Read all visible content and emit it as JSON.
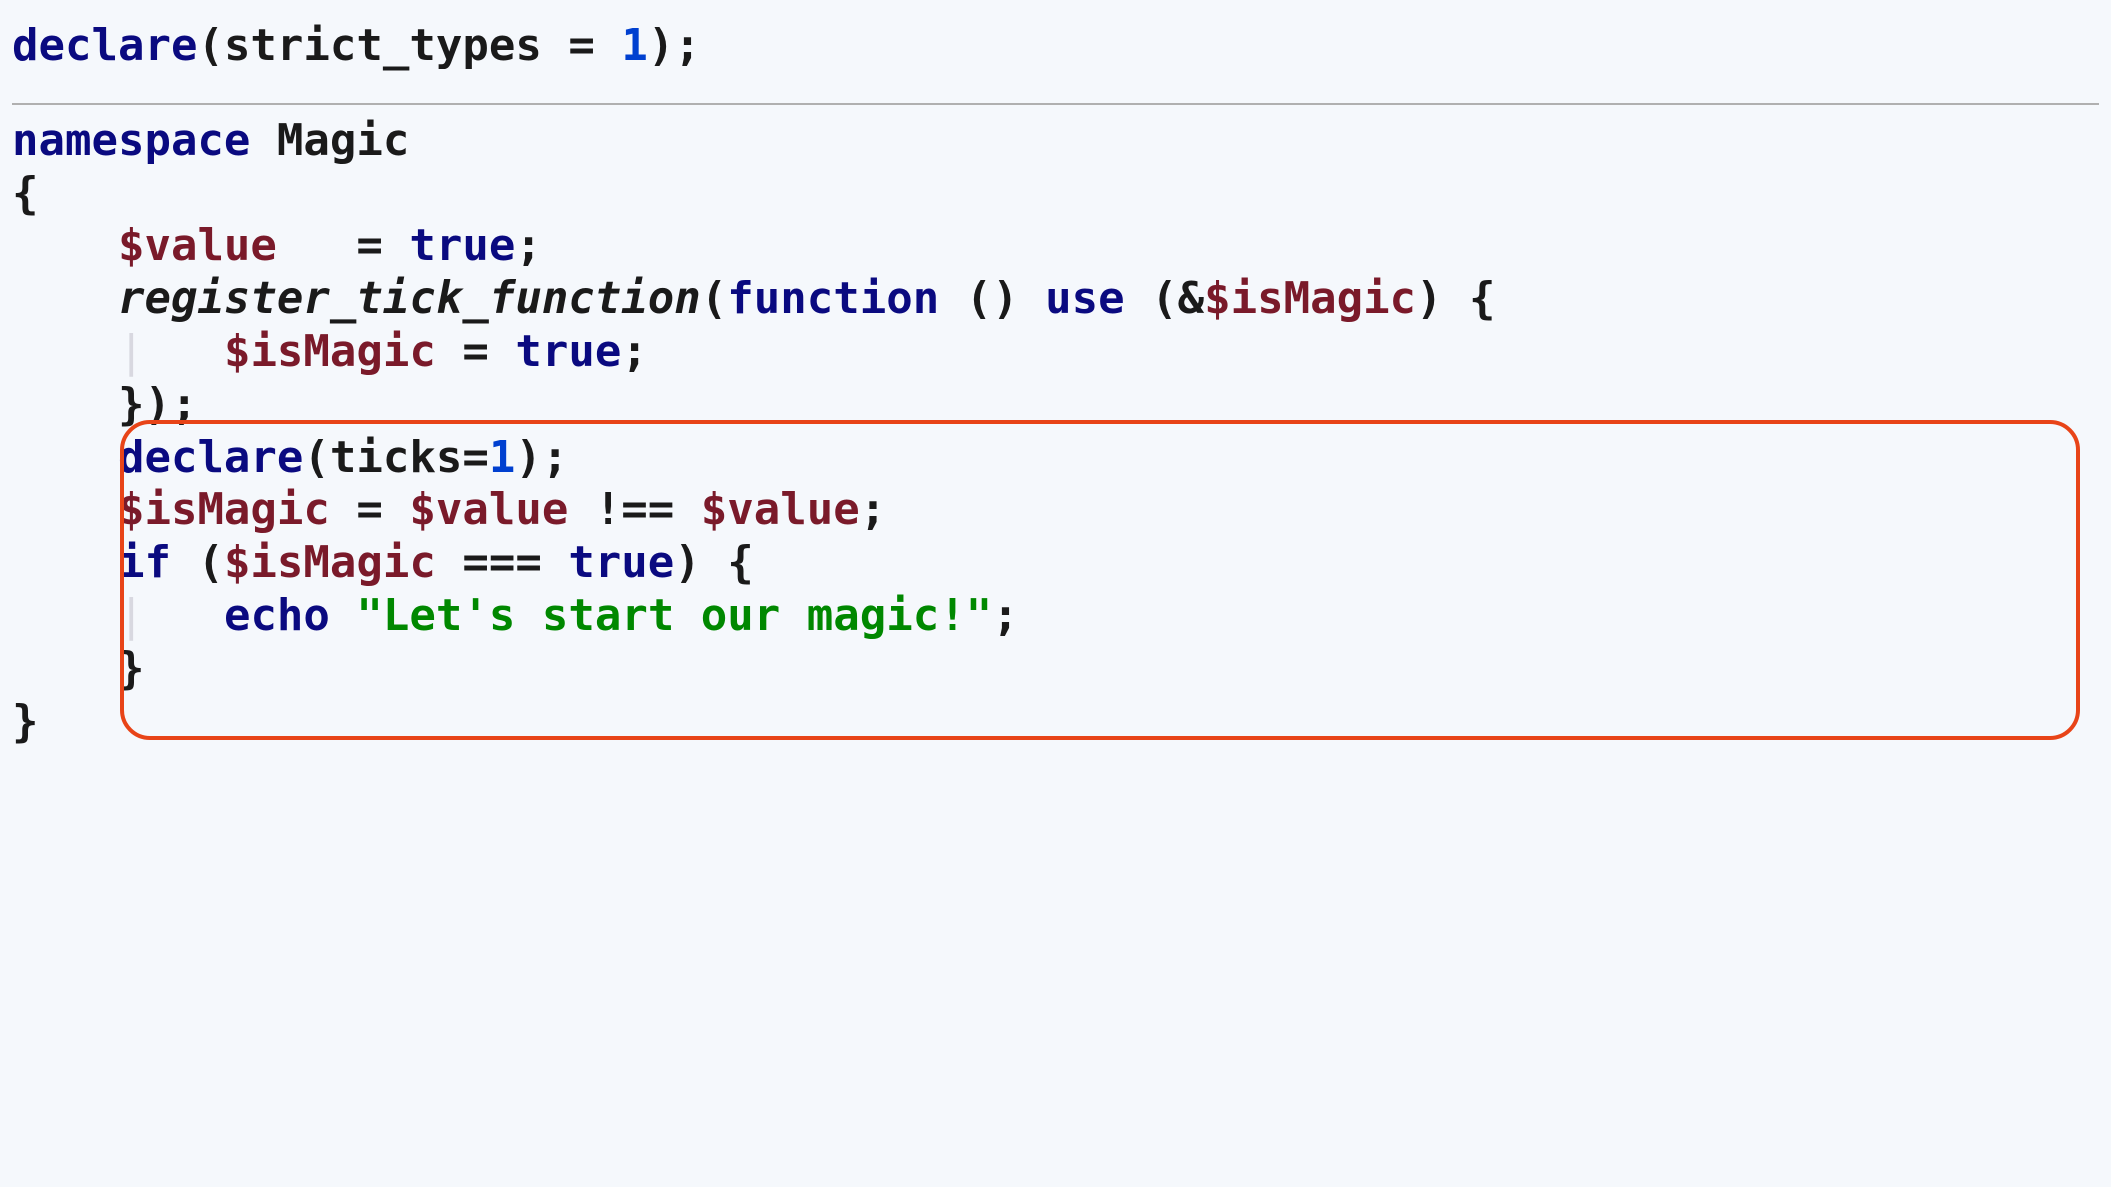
{
  "line1": {
    "declare": "declare",
    "paren_open": "(",
    "strict_types": "strict_types",
    "equals": " = ",
    "one": "1",
    "paren_close": ");"
  },
  "line2": {
    "namespace": "namespace",
    "name": " Magic"
  },
  "line3": {
    "brace": "{"
  },
  "line4": {
    "indent": "    ",
    "var": "$value",
    "spaces": "   ",
    "equals": "= ",
    "true": "true",
    "semi": ";"
  },
  "line5": {
    "indent": "    ",
    "func": "register_tick_function",
    "paren": "(",
    "function": "function",
    "parens": " () ",
    "use": "use",
    "open": " (&",
    "var": "$isMagic",
    "close": ") {"
  },
  "line6": {
    "indent": "    ",
    "guide": "|",
    "indent2": "   ",
    "var": "$isMagic",
    "equals": " = ",
    "true": "true",
    "semi": ";"
  },
  "line7": {
    "indent": "    ",
    "close": "});"
  },
  "line8": {
    "indent": "    ",
    "declare": "declare",
    "paren": "(",
    "ticks": "ticks",
    "equals": "=",
    "one": "1",
    "close": ");"
  },
  "line9": {
    "indent": "    ",
    "var1": "$isMagic",
    "equals": " = ",
    "var2": "$value",
    "op": " !== ",
    "var3": "$value",
    "semi": ";"
  },
  "line10": {
    "indent": "    ",
    "if": "if",
    "open": " (",
    "var": "$isMagic",
    "op": " === ",
    "true": "true",
    "close": ") {"
  },
  "line11": {
    "indent": "    ",
    "guide": "|",
    "indent2": "   ",
    "echo": "echo",
    "space": " ",
    "string": "\"Let's start our magic!\"",
    "semi": ";"
  },
  "line12": {
    "indent": "    ",
    "brace": "}"
  },
  "line13": {
    "brace": "}"
  }
}
